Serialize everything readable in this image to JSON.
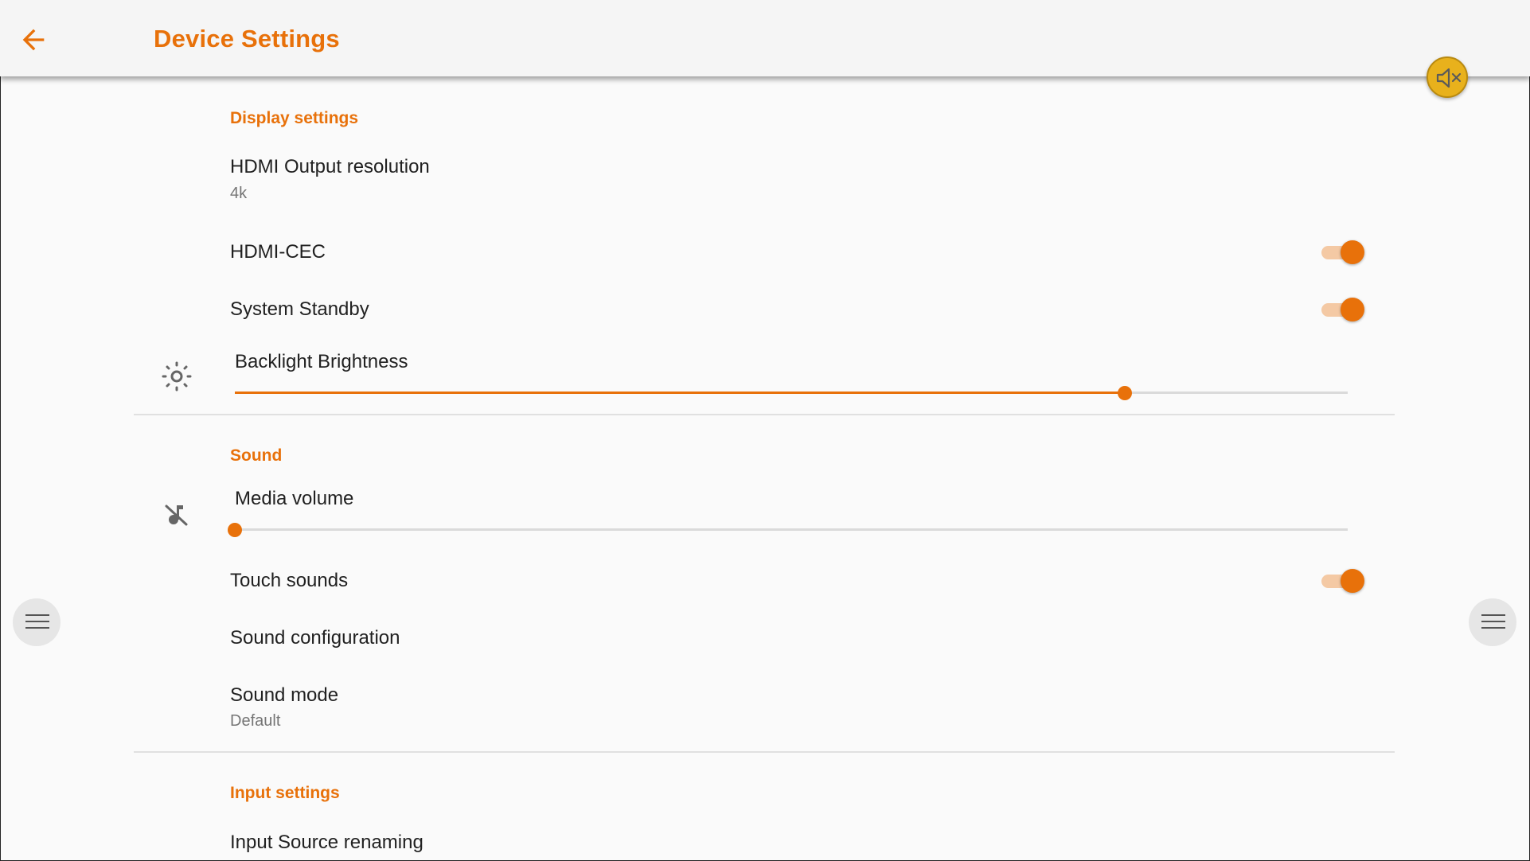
{
  "header": {
    "title": "Device Settings"
  },
  "sections": {
    "display": {
      "header": "Display settings",
      "hdmi_output": {
        "title": "HDMI Output resolution",
        "value": "4k"
      },
      "hdmi_cec": {
        "title": "HDMI-CEC",
        "enabled": true
      },
      "system_standby": {
        "title": "System Standby",
        "enabled": true
      },
      "backlight": {
        "title": "Backlight Brightness",
        "level_fraction": 0.8
      }
    },
    "sound": {
      "header": "Sound",
      "media_volume": {
        "title": "Media volume",
        "level_fraction": 0.0
      },
      "touch_sounds": {
        "title": "Touch sounds",
        "enabled": true
      },
      "sound_configuration": {
        "title": "Sound configuration"
      },
      "sound_mode": {
        "title": "Sound mode",
        "value": "Default"
      }
    },
    "input": {
      "header": "Input settings",
      "input_source_renaming": {
        "title": "Input Source renaming"
      }
    }
  },
  "icons": {
    "back": "arrow-back-icon",
    "mute_fab": "volume-mute-icon",
    "brightness": "brightness-icon",
    "media": "music-off-icon",
    "side_menu": "menu-icon"
  },
  "colors": {
    "accent": "#e8710a",
    "accent_light": "#f4c9a4",
    "mute_fab": "#e8b11c"
  }
}
